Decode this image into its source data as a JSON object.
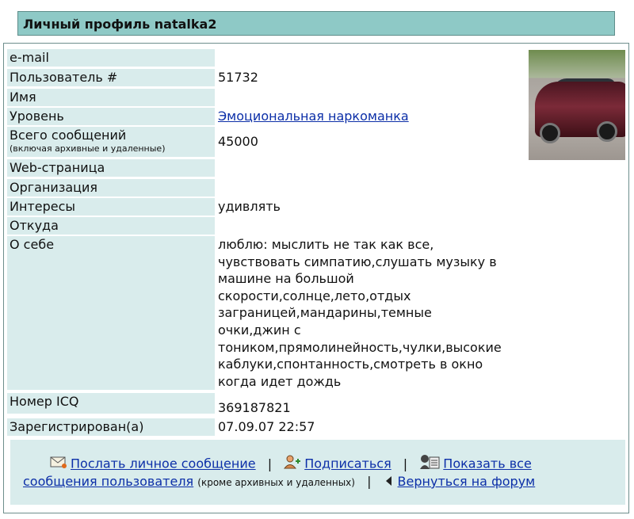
{
  "title": "Личный профиль natalka2",
  "rows": {
    "email": {
      "label": "e-mail",
      "value": ""
    },
    "user_num": {
      "label": "Пользователь #",
      "value": "51732"
    },
    "name": {
      "label": "Имя",
      "value": ""
    },
    "level": {
      "label": "Уровень",
      "value": "Эмоциональная наркоманка"
    },
    "posts": {
      "label": "Всего сообщений",
      "sublabel": "(включая архивные и удаленные)",
      "value": "45000"
    },
    "web": {
      "label": "Web-страница",
      "value": ""
    },
    "org": {
      "label": "Организация",
      "value": ""
    },
    "interests": {
      "label": "Интересы",
      "value": "удивлять"
    },
    "from": {
      "label": "Откуда",
      "value": ""
    },
    "about": {
      "label": "О себе",
      "lines": [
        "люблю: мыслить не так как все,",
        "чувствовать симпатию,слушать музыку в",
        "машине на большой",
        "скорости,солнце,лето,отдых",
        "заграницей,мандарины,темные",
        "очки,джин с",
        "тоником,прямолинейность,чулки,высокие",
        "каблуки,спонтанность,смотреть в окно",
        "когда идет дождь"
      ]
    },
    "icq": {
      "label": "Номер ICQ",
      "value": "369187821"
    },
    "registered": {
      "label": "Зарегистрирован(а)",
      "value": "07.09.07 22:57"
    }
  },
  "footer": {
    "send_message": "Послать личное сообщение",
    "subscribe": "Подписаться",
    "show_all_1": "Показать все",
    "show_all_2": "сообщения пользователя",
    "show_all_note": "(кроме архивных и удаленных)",
    "back_to_forum": "Вернуться на форум",
    "separator": "|"
  },
  "icons": {
    "envelope": "envelope-icon",
    "subscribe": "subscribe-icon",
    "users": "users-icon",
    "back": "back-arrow-icon"
  },
  "colors": {
    "accent": "#8ec9c6",
    "label_bg": "#d9ecec",
    "link": "#0c2fa8"
  }
}
